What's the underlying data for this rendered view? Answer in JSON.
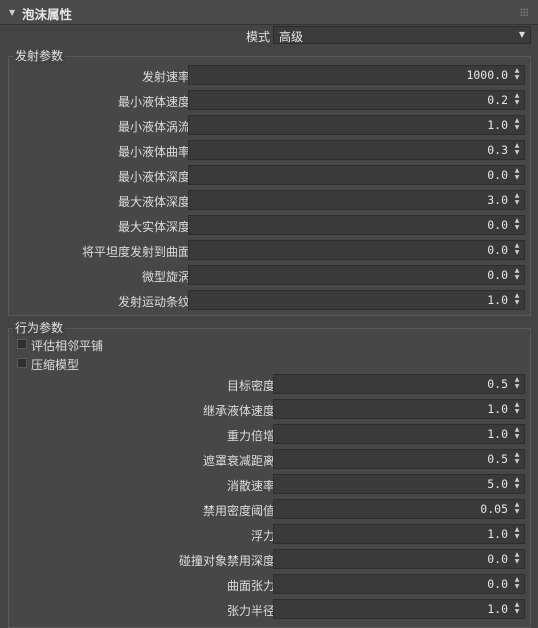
{
  "panel": {
    "title": "泡沫属性"
  },
  "mode": {
    "label": "模式",
    "value": "高级"
  },
  "emission": {
    "title": "发射参数",
    "rows": [
      {
        "label": "发射速率:",
        "value": "1000.0"
      },
      {
        "label": "最小液体速度:",
        "value": "0.2"
      },
      {
        "label": "最小液体涡流:",
        "value": "1.0"
      },
      {
        "label": "最小液体曲率:",
        "value": "0.3"
      },
      {
        "label": "最小液体深度:",
        "value": "0.0"
      },
      {
        "label": "最大液体深度:",
        "value": "3.0"
      },
      {
        "label": "最大实体深度:",
        "value": "0.0"
      },
      {
        "label": "将平坦度发射到曲面:",
        "value": "0.0"
      },
      {
        "label": "微型旋涡:",
        "value": "0.0"
      },
      {
        "label": "发射运动条纹:",
        "value": "1.0"
      }
    ]
  },
  "behavior": {
    "title": "行为参数",
    "checkboxes": [
      {
        "label": "评估相邻平铺",
        "checked": false
      },
      {
        "label": "压缩模型",
        "checked": false
      }
    ],
    "rows": [
      {
        "label": "目标密度:",
        "value": "0.5"
      },
      {
        "label": "继承液体速度:",
        "value": "1.0"
      },
      {
        "label": "重力倍增:",
        "value": "1.0"
      },
      {
        "label": "遮罩衰减距离:",
        "value": "0.5"
      },
      {
        "label": "消散速率:",
        "value": "5.0"
      },
      {
        "label": "禁用密度阈值:",
        "value": "0.05"
      },
      {
        "label": "浮力:",
        "value": "1.0"
      },
      {
        "label": "碰撞对象禁用深度:",
        "value": "0.0"
      },
      {
        "label": "曲面张力:",
        "value": "0.0"
      },
      {
        "label": "张力半径:",
        "value": "1.0"
      }
    ]
  }
}
